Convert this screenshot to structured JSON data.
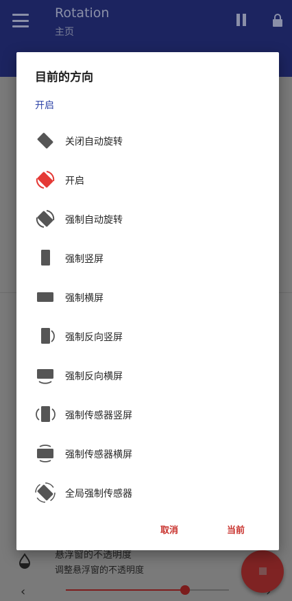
{
  "app": {
    "title": "Rotation",
    "subtitle": "主页"
  },
  "dialog": {
    "title": "目前的方向",
    "current": "开启",
    "options": [
      {
        "label": "关闭自动旋转",
        "icon": "auto-rotate-off-icon"
      },
      {
        "label": "开启",
        "icon": "auto-rotate-on-icon"
      },
      {
        "label": "强制自动旋转",
        "icon": "force-auto-rotate-icon"
      },
      {
        "label": "强制竖屏",
        "icon": "portrait-icon"
      },
      {
        "label": "强制横屏",
        "icon": "landscape-icon"
      },
      {
        "label": "强制反向竖屏",
        "icon": "reverse-portrait-icon"
      },
      {
        "label": "强制反向横屏",
        "icon": "reverse-landscape-icon"
      },
      {
        "label": "强制传感器竖屏",
        "icon": "sensor-portrait-icon"
      },
      {
        "label": "强制传感器横屏",
        "icon": "sensor-landscape-icon"
      },
      {
        "label": "全局强制传感器",
        "icon": "global-sensor-icon"
      }
    ],
    "cancel": "取消",
    "confirm": "当前"
  },
  "bottom": {
    "opacity_title": "悬浮窗的不透明度",
    "opacity_desc": "调整悬浮窗的不透明度",
    "prev": "‹",
    "next": "›",
    "slider_value": 0.73
  },
  "colors": {
    "accent": "#e53935",
    "primary": "#2f45a8",
    "icon": "#555555"
  }
}
